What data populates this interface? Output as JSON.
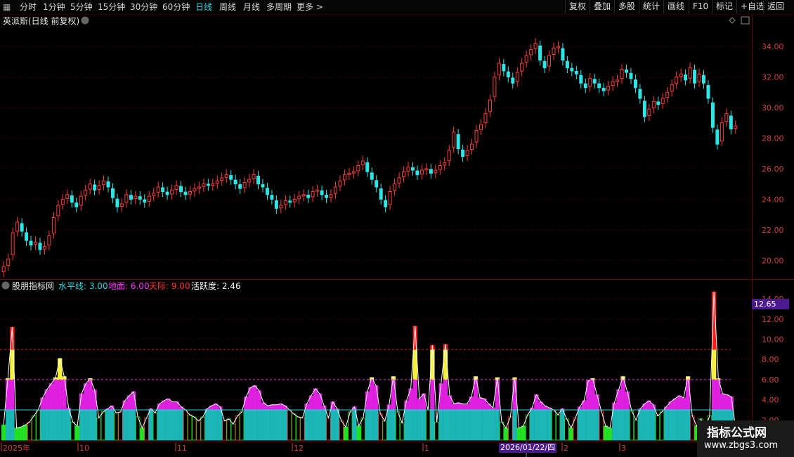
{
  "toolbar": {
    "left_icon": "grid-icon",
    "periods": [
      "分时",
      "1分钟",
      "5分钟",
      "15分钟",
      "30分钟",
      "60分钟",
      "日线",
      "周线",
      "月线",
      "多周期",
      "更多 >"
    ],
    "active_period": "日线",
    "right_buttons": [
      "复权",
      "叠加",
      "多股",
      "统计",
      "画线",
      "F10",
      "标记",
      "+自选",
      "返回"
    ]
  },
  "main_panel": {
    "stock_title": "英派斯(日线 前复权)"
  },
  "indicator_panel": {
    "name": "股朋指标网",
    "values": [
      {
        "label": "水平线: 3.00",
        "color": "#29d9e6"
      },
      {
        "label": "地面: 6.00",
        "color": "#ff33ff"
      },
      {
        "label": "天际: 9.00",
        "color": "#ff3333"
      },
      {
        "label": "活跃度: 2.46",
        "color": "#ffffff"
      }
    ],
    "price_tip": "12.65",
    "date_tip": "2026/01/22/四"
  },
  "x_axis_labels": [
    "2025年",
    "10",
    "11",
    "12",
    "1",
    "2",
    "3"
  ],
  "watermark": {
    "title": "指标公式网",
    "url": "www.zbgs3.com"
  },
  "colors": {
    "up": "#ff3b3b",
    "down": "#2de6e6",
    "bg": "#000000",
    "grid": "#3a0000"
  },
  "chart_data": [
    {
      "type": "candlestick",
      "title": "英派斯(日线 前复权)",
      "y_ticks": [
        "34.00",
        "32.00",
        "30.00",
        "28.00",
        "26.00",
        "24.00",
        "22.00",
        "20.00"
      ],
      "ylim": [
        19.0,
        35.2
      ],
      "closes": [
        19.6,
        20.1,
        21.8,
        22.5,
        21.9,
        21.3,
        21.0,
        21.2,
        20.7,
        20.9,
        21.6,
        22.8,
        23.6,
        24.0,
        24.3,
        23.8,
        23.5,
        24.2,
        24.6,
        25.0,
        24.6,
        24.9,
        25.2,
        24.8,
        24.1,
        23.5,
        23.7,
        24.3,
        24.0,
        24.2,
        24.0,
        23.8,
        24.2,
        24.4,
        24.8,
        24.5,
        24.3,
        24.6,
        24.9,
        24.5,
        24.3,
        24.5,
        24.7,
        24.8,
        25.0,
        24.9,
        25.0,
        25.2,
        25.4,
        25.6,
        25.3,
        25.0,
        24.7,
        25.1,
        25.3,
        25.6,
        25.0,
        24.8,
        24.3,
        24.0,
        23.4,
        23.6,
        23.9,
        23.8,
        24.0,
        24.2,
        24.3,
        24.1,
        24.5,
        24.6,
        24.3,
        24.1,
        24.3,
        24.8,
        25.2,
        25.6,
        25.7,
        25.8,
        26.2,
        26.5,
        25.8,
        25.3,
        24.8,
        24.0,
        23.5,
        24.5,
        25.0,
        25.4,
        25.8,
        26.1,
        25.9,
        25.6,
        25.9,
        26.0,
        25.7,
        25.9,
        26.2,
        26.4,
        27.2,
        28.4,
        27.3,
        26.8,
        27.2,
        27.6,
        28.5,
        28.9,
        29.6,
        30.5,
        32.0,
        32.9,
        32.4,
        32.0,
        31.6,
        32.3,
        32.9,
        33.4,
        33.8,
        34.2,
        33.1,
        32.6,
        33.4,
        33.9,
        34.0,
        33.1,
        32.6,
        32.4,
        32.2,
        31.6,
        31.3,
        31.9,
        31.6,
        31.3,
        31.1,
        31.4,
        31.7,
        31.8,
        32.5,
        32.3,
        31.9,
        31.3,
        30.6,
        29.4,
        29.9,
        30.4,
        30.2,
        30.6,
        31.0,
        31.5,
        32.0,
        32.2,
        31.8,
        32.6,
        31.6,
        32.2,
        31.6,
        30.6,
        28.7,
        27.6,
        29.0,
        29.6,
        28.6,
        28.8
      ]
    },
    {
      "type": "bar",
      "title": "股朋指标网",
      "y_ticks": [
        "14.00",
        "12.00",
        "10.00",
        "8.00",
        "6.00",
        "4.00",
        "2.00"
      ],
      "ylim": [
        0,
        14.5
      ],
      "reference_lines": [
        {
          "name": "水平线",
          "value": 3.0
        },
        {
          "name": "地面",
          "value": 6.0
        },
        {
          "name": "天际",
          "value": 9.0
        }
      ],
      "activity": 2.46,
      "values": [
        1.5,
        6.1,
        11.2,
        1.2,
        1.3,
        1.5,
        1.8,
        2.4,
        3.0,
        4.2,
        5.0,
        5.6,
        6.2,
        8.1,
        6.3,
        3.2,
        1.8,
        1.4,
        4.6,
        5.6,
        6.1,
        5.0,
        2.2,
        2.8,
        3.1,
        3.4,
        2.7,
        2.8,
        3.9,
        4.4,
        4.8,
        2.3,
        1.2,
        2.2,
        3.1,
        2.7,
        3.6,
        3.9,
        4.1,
        3.8,
        3.8,
        3.3,
        3.0,
        2.5,
        2.3,
        1.9,
        2.3,
        3.1,
        3.4,
        3.6,
        3.3,
        1.9,
        2.1,
        1.6,
        2.4,
        2.8,
        4.3,
        5.2,
        5.4,
        4.9,
        3.7,
        3.4,
        3.5,
        3.5,
        3.6,
        3.4,
        3.0,
        2.6,
        2.3,
        2.2,
        3.6,
        4.4,
        5.1,
        4.6,
        3.4,
        2.2,
        3.8,
        3.1,
        1.9,
        1.3,
        2.8,
        3.3,
        1.4,
        2.2,
        4.8,
        6.2,
        5.4,
        2.6,
        1.9,
        3.5,
        6.3,
        2.8,
        1.7,
        3.9,
        5.1,
        11.3,
        4.1,
        4.6,
        3.0,
        9.4,
        1.8,
        5.6,
        9.5,
        4.4,
        3.6,
        3.7,
        3.6,
        3.6,
        4.3,
        6.3,
        4.2,
        4.1,
        3.6,
        3.2,
        6.2,
        1.8,
        1.2,
        2.3,
        6.2,
        1.2,
        1.4,
        2.5,
        3.2,
        4.5,
        3.8,
        3.4,
        3.2,
        3.0,
        2.5,
        3.1,
        2.1,
        1.2,
        2.2,
        3.3,
        3.9,
        5.9,
        6.1,
        4.5,
        2.9,
        1.4,
        1.2,
        3.7,
        5.0,
        6.3,
        4.8,
        2.9,
        2.0,
        3.1,
        3.6,
        3.9,
        3.5,
        2.4,
        2.8,
        3.3,
        3.8,
        4.1,
        4.4,
        4.2,
        6.3,
        2.4,
        1.4,
        2.1,
        1.2,
        2.4,
        14.7,
        6.1,
        4.6,
        4.5,
        4.3,
        1.2
      ]
    }
  ]
}
